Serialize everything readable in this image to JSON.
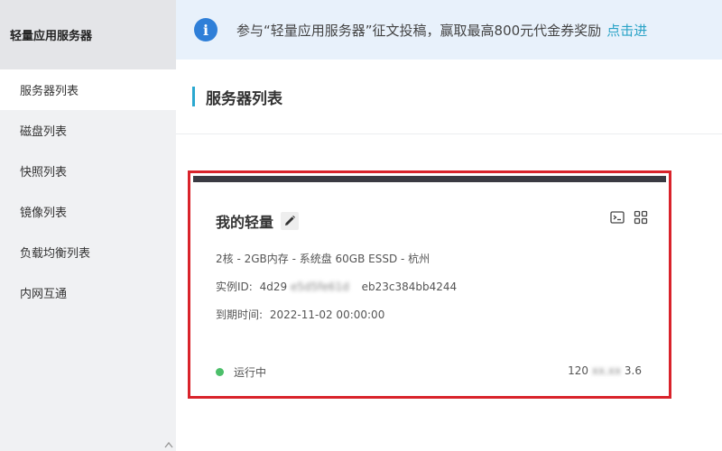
{
  "sidebar": {
    "title": "轻量应用服务器",
    "items": [
      {
        "label": "服务器列表",
        "active": true
      },
      {
        "label": "磁盘列表"
      },
      {
        "label": "快照列表"
      },
      {
        "label": "镜像列表"
      },
      {
        "label": "负载均衡列表"
      },
      {
        "label": "内网互通"
      }
    ]
  },
  "notice": {
    "icon": "i",
    "text": "参与“轻量应用服务器”征文投稿，赢取最高800元代金券奖励",
    "link": "点击进"
  },
  "main": {
    "title": "服务器列表"
  },
  "card": {
    "name": "我的轻量",
    "spec": "2核 - 2GB内存 - 系统盘 60GB ESSD - 杭州",
    "instance_label": "实例ID:",
    "instance_prefix": "4d29",
    "instance_blurred": "e5d5fe61d",
    "instance_suffix": "eb23c384bb4244",
    "expire_label": "到期时间:",
    "expire_value": "2022-11-02 00:00:00",
    "status": "运行中",
    "status_color": "#4cbf6a",
    "ip_prefix": "120",
    "ip_blurred": "xx.xx",
    "ip_suffix": "3.6"
  },
  "colors": {
    "accent": "#2aa8d0",
    "highlight": "#d9232b",
    "info": "#2f7fd8",
    "link": "#2aa3c7"
  }
}
